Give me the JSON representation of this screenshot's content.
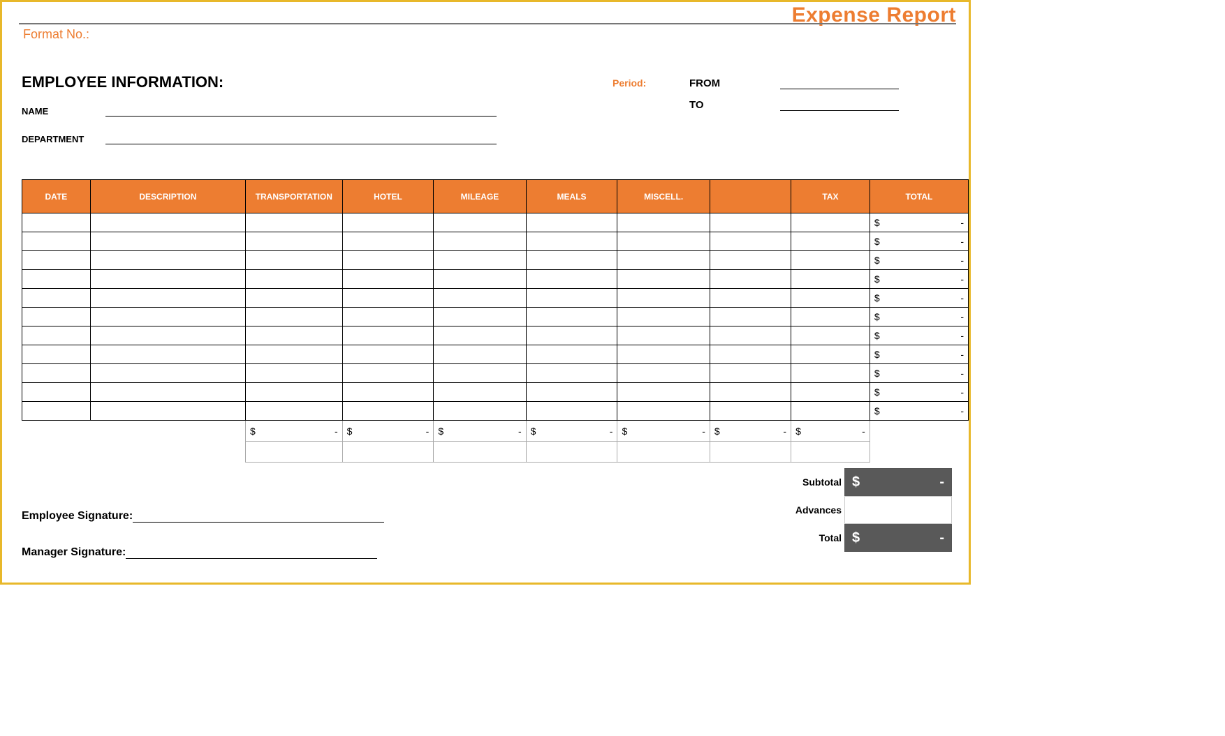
{
  "title": "Expense Report",
  "format_no_label": "Format No.:",
  "employee_info": {
    "header": "EMPLOYEE INFORMATION:",
    "name_label": "NAME",
    "department_label": "DEPARTMENT"
  },
  "period": {
    "label": "Period:",
    "from_label": "FROM",
    "to_label": "TO"
  },
  "table": {
    "headers": {
      "date": "DATE",
      "description": "DESCRIPTION",
      "transportation": "TRANSPORTATION",
      "hotel": "HOTEL",
      "mileage": "MILEAGE",
      "meals": "MEALS",
      "miscell": "MISCELL.",
      "blank": "",
      "tax": "TAX",
      "total": "TOTAL"
    },
    "rows": [
      {
        "total_sym": "$",
        "total_val": "-"
      },
      {
        "total_sym": "$",
        "total_val": "-"
      },
      {
        "total_sym": "$",
        "total_val": "-"
      },
      {
        "total_sym": "$",
        "total_val": "-"
      },
      {
        "total_sym": "$",
        "total_val": "-"
      },
      {
        "total_sym": "$",
        "total_val": "-"
      },
      {
        "total_sym": "$",
        "total_val": "-"
      },
      {
        "total_sym": "$",
        "total_val": "-"
      },
      {
        "total_sym": "$",
        "total_val": "-"
      },
      {
        "total_sym": "$",
        "total_val": "-"
      },
      {
        "total_sym": "$",
        "total_val": "-"
      }
    ],
    "col_totals": {
      "transportation": {
        "sym": "$",
        "val": "-"
      },
      "hotel": {
        "sym": "$",
        "val": "-"
      },
      "mileage": {
        "sym": "$",
        "val": "-"
      },
      "meals": {
        "sym": "$",
        "val": "-"
      },
      "miscell": {
        "sym": "$",
        "val": "-"
      },
      "blank": {
        "sym": "$",
        "val": "-"
      },
      "tax": {
        "sym": "$",
        "val": "-"
      }
    }
  },
  "summary": {
    "subtotal_label": "Subtotal",
    "subtotal_sym": "$",
    "subtotal_val": "-",
    "advances_label": "Advances",
    "total_label": "Total",
    "total_sym": "$",
    "total_val": "-"
  },
  "signatures": {
    "employee_label": "Employee Signature:",
    "manager_label": "Manager Signature:"
  }
}
